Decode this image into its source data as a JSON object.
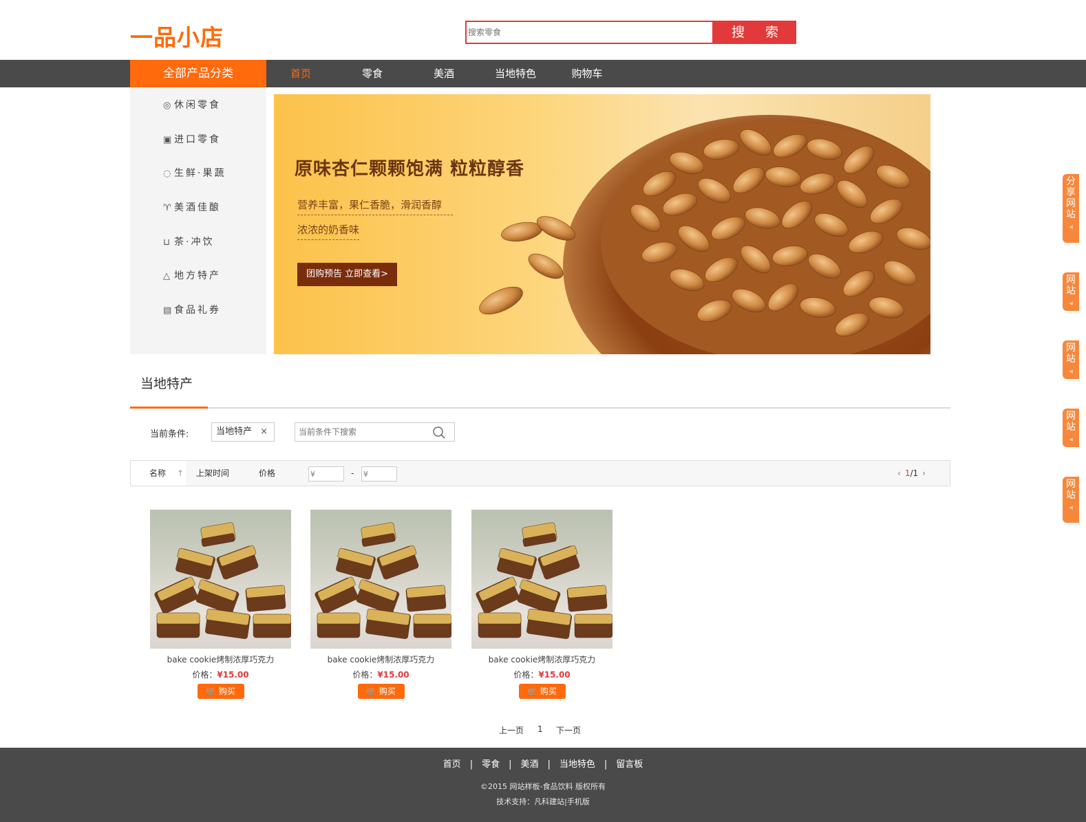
{
  "header": {
    "logo": "一品小店",
    "search_placeholder": "搜索零食",
    "search_button": "搜 索"
  },
  "nav": {
    "category_head": "全部产品分类",
    "items": [
      "首页",
      "零食",
      "美酒",
      "当地特色",
      "购物车"
    ],
    "active_index": 0
  },
  "sidebar": {
    "items": [
      {
        "icon": "snack-icon",
        "label": "休闲零食"
      },
      {
        "icon": "import-icon",
        "label": "进口零食"
      },
      {
        "icon": "apple-icon",
        "label": "生鲜·果蔬"
      },
      {
        "icon": "wine-glass-icon",
        "label": "美酒佳酿"
      },
      {
        "icon": "cup-icon",
        "label": "茶·冲饮"
      },
      {
        "icon": "mountain-icon",
        "label": "地方特产"
      },
      {
        "icon": "gift-card-icon",
        "label": "食品礼券"
      }
    ]
  },
  "banner": {
    "title": "原味杏仁颗颗饱满 粒粒醇香",
    "sub1": "营养丰富，果仁香脆，滑润香醇",
    "sub2": "浓浓的奶香味",
    "cta": "团购预告 立即查看>"
  },
  "section": {
    "title": "当地特产",
    "condition_label": "当前条件:",
    "condition_tag": "当地特产",
    "condition_remove": "×",
    "condition_search_placeholder": "当前条件下搜索"
  },
  "sortbar": {
    "name": "名称",
    "time": "上架时间",
    "price": "价格",
    "price_min_placeholder": "¥",
    "price_max_placeholder": "¥",
    "dash": "-",
    "page_current": "1",
    "page_total": "/1"
  },
  "products": [
    {
      "name": "bake cookie烤制浓厚巧克力",
      "price_label": "价格：",
      "price": "¥15.00",
      "buy": "购买"
    },
    {
      "name": "bake cookie烤制浓厚巧克力",
      "price_label": "价格：",
      "price": "¥15.00",
      "buy": "购买"
    },
    {
      "name": "bake cookie烤制浓厚巧克力",
      "price_label": "价格：",
      "price": "¥15.00",
      "buy": "购买"
    }
  ],
  "pager": {
    "prev": "上一页",
    "page": "1",
    "next": "下一页"
  },
  "footer": {
    "links": [
      "首页",
      "零食",
      "美酒",
      "当地特色",
      "留言板"
    ],
    "separator": "|",
    "copyright": "©2015 网站样板-食品饮料 版权所有",
    "tech": "技术支持：凡科建站|手机版"
  },
  "side_tabs": [
    "分享网站",
    "网站",
    "网站",
    "网站",
    "网站"
  ],
  "colors": {
    "accent": "#ff6a0c",
    "search_red": "#e23a3a",
    "nav_bg": "#4a4a4a"
  }
}
